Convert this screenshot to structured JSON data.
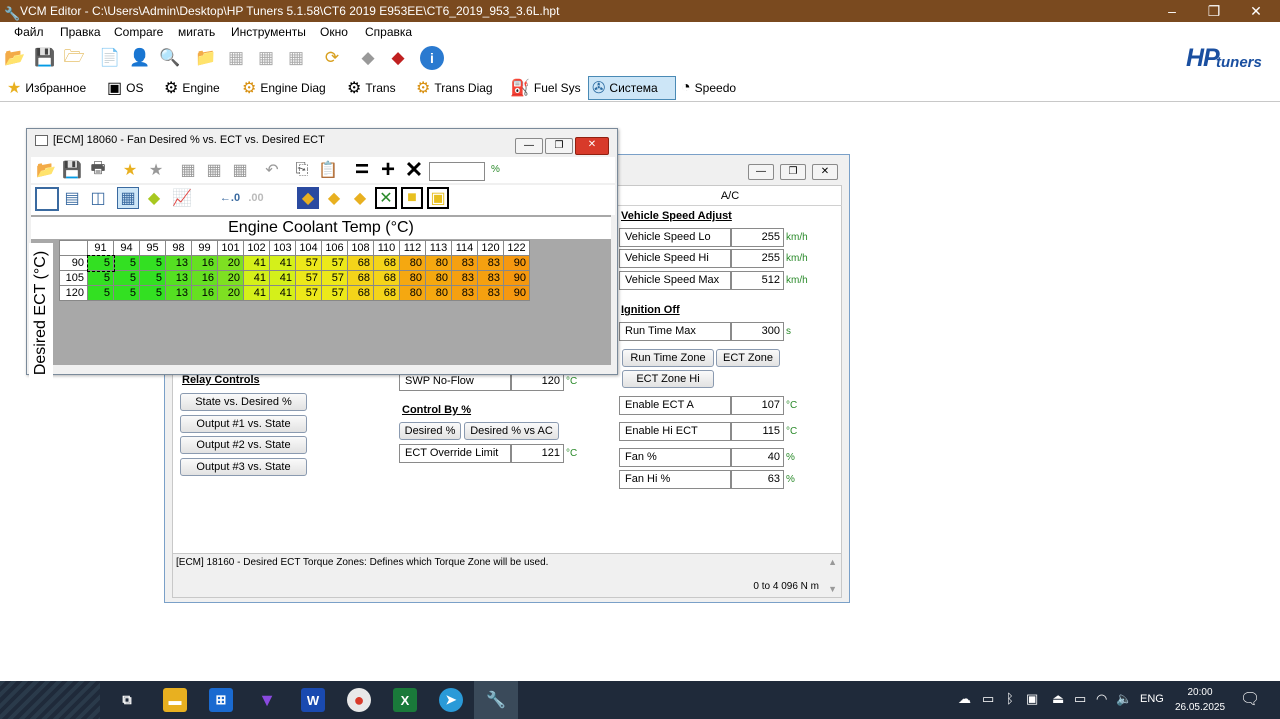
{
  "app": {
    "title": "VCM Editor - C:\\Users\\Admin\\Desktop\\HP Tuners 5.1.58\\CT6 2019 E953EE\\CT6_2019_953_3.6L.hpt",
    "logo_primary": "HP",
    "logo_secondary": "tuners"
  },
  "menu": [
    "Файл",
    "Правка",
    "Compare",
    "мигать",
    "Инструменты",
    "Окно",
    "Справка"
  ],
  "nav_tabs": [
    {
      "label": "Избранное",
      "icon": "star-icon"
    },
    {
      "label": "OS",
      "icon": "chip-icon"
    },
    {
      "label": "Engine",
      "icon": "engine-icon"
    },
    {
      "label": "Engine Diag",
      "icon": "check-engine-icon"
    },
    {
      "label": "Trans",
      "icon": "gear-icon"
    },
    {
      "label": "Trans Diag",
      "icon": "gear-diag-icon"
    },
    {
      "label": "Fuel Sys",
      "icon": "fuel-pump-icon"
    },
    {
      "label": "Система",
      "icon": "fan-icon",
      "active": true
    },
    {
      "label": "Speedo",
      "icon": "speedometer-icon"
    }
  ],
  "table_window": {
    "title": "[ECM] 18060 - Fan Desired % vs. ECT vs. Desired ECT",
    "unit_label": "%",
    "x_axis_label": "Engine Coolant Temp (°C)",
    "y_axis_label": "Desired ECT (°C)",
    "columns": [
      "91",
      "94",
      "95",
      "98",
      "99",
      "101",
      "102",
      "103",
      "104",
      "106",
      "108",
      "110",
      "112",
      "113",
      "114",
      "120",
      "122"
    ],
    "rows": [
      {
        "label": "90",
        "values": [
          "5",
          "5",
          "5",
          "13",
          "16",
          "20",
          "41",
          "41",
          "57",
          "57",
          "68",
          "68",
          "80",
          "80",
          "83",
          "83",
          "90"
        ]
      },
      {
        "label": "105",
        "values": [
          "5",
          "5",
          "5",
          "13",
          "16",
          "20",
          "41",
          "41",
          "57",
          "57",
          "68",
          "68",
          "80",
          "80",
          "83",
          "83",
          "90"
        ]
      },
      {
        "label": "120",
        "values": [
          "5",
          "5",
          "5",
          "13",
          "16",
          "20",
          "41",
          "41",
          "57",
          "57",
          "68",
          "68",
          "80",
          "80",
          "83",
          "83",
          "90"
        ]
      }
    ],
    "cell_colors": [
      "#33e022",
      "#33e022",
      "#33e022",
      "#55e022",
      "#66e022",
      "#7ee022",
      "#d4f01a",
      "#d4f01a",
      "#ece81a",
      "#ece81a",
      "#f4d41a",
      "#f4d41a",
      "#f5a810",
      "#f5a810",
      "#f5a010",
      "#f5a010",
      "#f59810"
    ]
  },
  "system_window": {
    "tab_ac": "A/C",
    "vehicle_speed_adjust": {
      "heading": "Vehicle Speed Adjust",
      "fields": [
        {
          "label": "Vehicle Speed Lo",
          "value": "255",
          "unit": "km/h"
        },
        {
          "label": "Vehicle Speed Hi",
          "value": "255",
          "unit": "km/h"
        },
        {
          "label": "Vehicle Speed Max",
          "value": "512",
          "unit": "km/h"
        }
      ]
    },
    "ignition_off": {
      "heading": "Ignition Off",
      "run_time_max": {
        "label": "Run Time Max",
        "value": "300",
        "unit": "s"
      },
      "buttons": [
        "Run Time Zone",
        "ECT Zone",
        "ECT Zone Hi"
      ],
      "enable_ect_a": {
        "label": "Enable ECT A",
        "value": "107",
        "unit": "°C"
      },
      "enable_hi_ect": {
        "label": "Enable Hi ECT",
        "value": "115",
        "unit": "°C"
      },
      "fan": {
        "label": "Fan %",
        "value": "40",
        "unit": "%"
      },
      "fan_hi": {
        "label": "Fan Hi %",
        "value": "63",
        "unit": "%"
      }
    },
    "relay_controls": {
      "heading": "Relay Controls",
      "buttons": [
        "State vs. Desired %",
        "Output #1 vs. State",
        "Output #2 vs. State",
        "Output #3 vs. State"
      ]
    },
    "swp_no_flow": {
      "label": "SWP No-Flow",
      "value": "120",
      "unit": "°C"
    },
    "control_by": {
      "heading": "Control By %",
      "buttons": [
        "Desired %",
        "Desired % vs AC"
      ],
      "ect_override": {
        "label": "ECT Override Limit",
        "value": "121",
        "unit": "°C"
      }
    },
    "description": "[ECM] 18160 - Desired ECT Torque Zones: Defines which Torque Zone will be used.",
    "range": "0 to 4 096 N m"
  },
  "taskbar": {
    "language": "ENG",
    "time": "20:00",
    "date": "26.05.2025"
  }
}
